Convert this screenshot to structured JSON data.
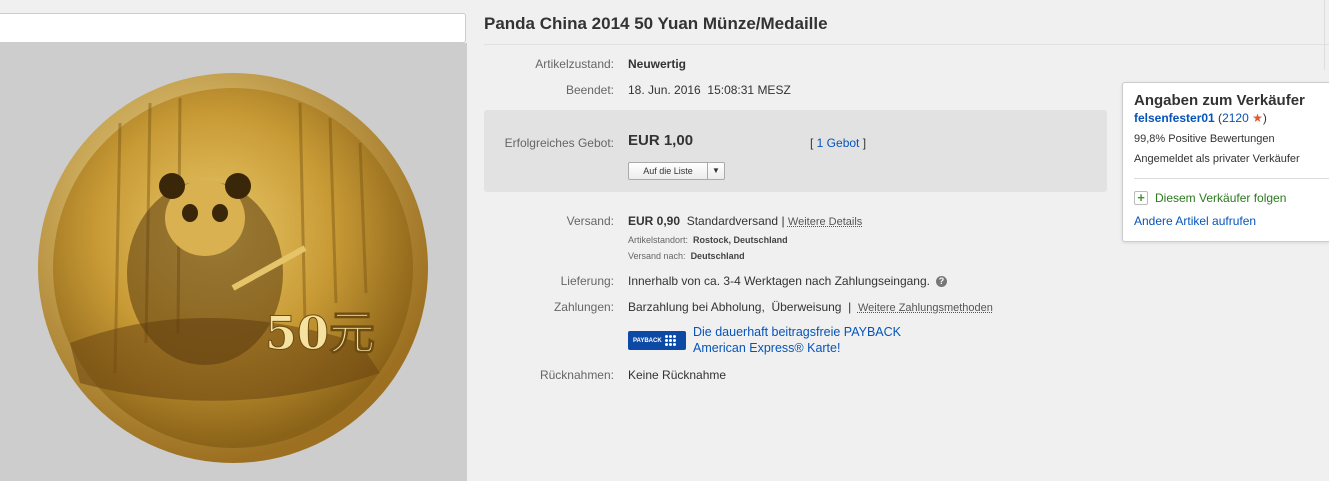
{
  "listing": {
    "title": "Panda China 2014 50 Yuan Münze/Medaille"
  },
  "details": {
    "condition_label": "Artikelzustand:",
    "condition_value": "Neuwertig",
    "ended_label": "Beendet:",
    "ended_value": "18. Jun. 2016  15:08:31 MESZ",
    "bid_label": "Erfolgreiches Gebot:",
    "bid_value": "EUR 1,00",
    "bid_count_open": "[ ",
    "bid_count": "1 Gebot",
    "bid_count_close": " ]",
    "watch_button": "Auf die Liste",
    "watch_dropdown_icon": "caret-down-icon",
    "shipping_label": "Versand:",
    "shipping_price": "EUR 0,90",
    "shipping_method": "Standardversand",
    "shipping_separator": "|",
    "shipping_details_link": "Weitere Details",
    "location_label": "Artikelstandort:",
    "location_value": "Rostock, Deutschland",
    "ships_to_label": "Versand nach:",
    "ships_to_value": "Deutschland",
    "delivery_label": "Lieferung:",
    "delivery_value": "Innerhalb von ca. 3-4 Werktagen nach Zahlungseingang.",
    "payments_label": "Zahlungen:",
    "payments_value": "Barzahlung bei Abholung,  Überweisung",
    "payments_separator": "|",
    "payments_more_link": "Weitere Zahlungsmethoden",
    "payback_logo_text": "PAYBACK",
    "payback_line1": "Die dauerhaft beitragsfreie PAYBACK",
    "payback_line2": "American Express® Karte!",
    "returns_label": "Rücknahmen:",
    "returns_value": "Keine Rücknahme"
  },
  "seller": {
    "heading": "Angaben zum Verkäufer",
    "name": "felsenfester01",
    "score_open": " (",
    "score": "2120",
    "score_close": ")",
    "positive": "99,8% Positive Bewertungen",
    "registered": "Angemeldet als privater Verkäufer",
    "follow": "Diesem Verkäufer folgen",
    "other_items": "Andere Artikel aufrufen"
  },
  "coin": {
    "denomination": "50元"
  },
  "colors": {
    "link": "#0654ba",
    "star": "#e5572e",
    "follow_green": "#2a7a1c",
    "payback_blue": "#0d4aa5"
  }
}
